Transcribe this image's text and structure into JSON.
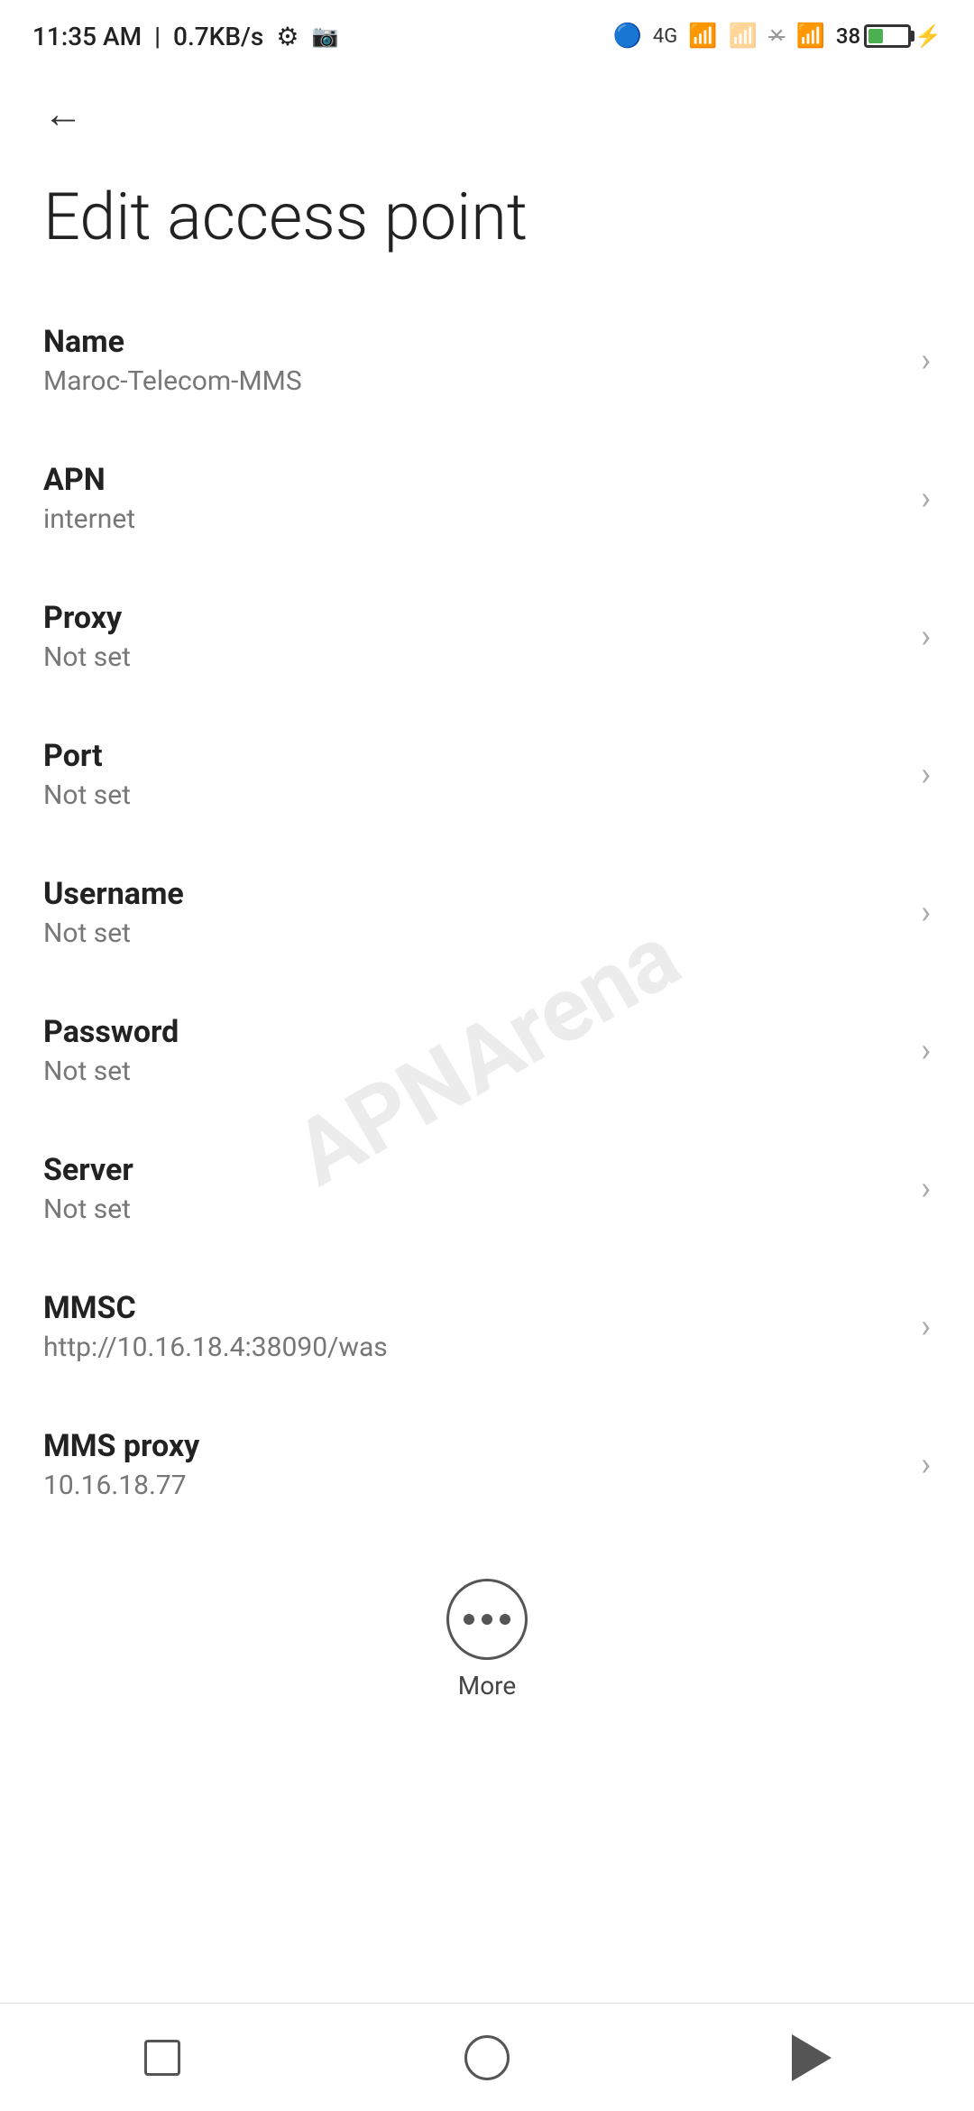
{
  "status_bar": {
    "time": "11:35 AM",
    "network_speed": "0.7KB/s"
  },
  "top_nav": {
    "back_label": "←"
  },
  "page": {
    "title": "Edit access point"
  },
  "settings_items": [
    {
      "label": "Name",
      "value": "Maroc-Telecom-MMS"
    },
    {
      "label": "APN",
      "value": "internet"
    },
    {
      "label": "Proxy",
      "value": "Not set"
    },
    {
      "label": "Port",
      "value": "Not set"
    },
    {
      "label": "Username",
      "value": "Not set"
    },
    {
      "label": "Password",
      "value": "Not set"
    },
    {
      "label": "Server",
      "value": "Not set"
    },
    {
      "label": "MMSC",
      "value": "http://10.16.18.4:38090/was"
    },
    {
      "label": "MMS proxy",
      "value": "10.16.18.77"
    }
  ],
  "more_button": {
    "label": "More"
  },
  "watermark": "APNArena"
}
